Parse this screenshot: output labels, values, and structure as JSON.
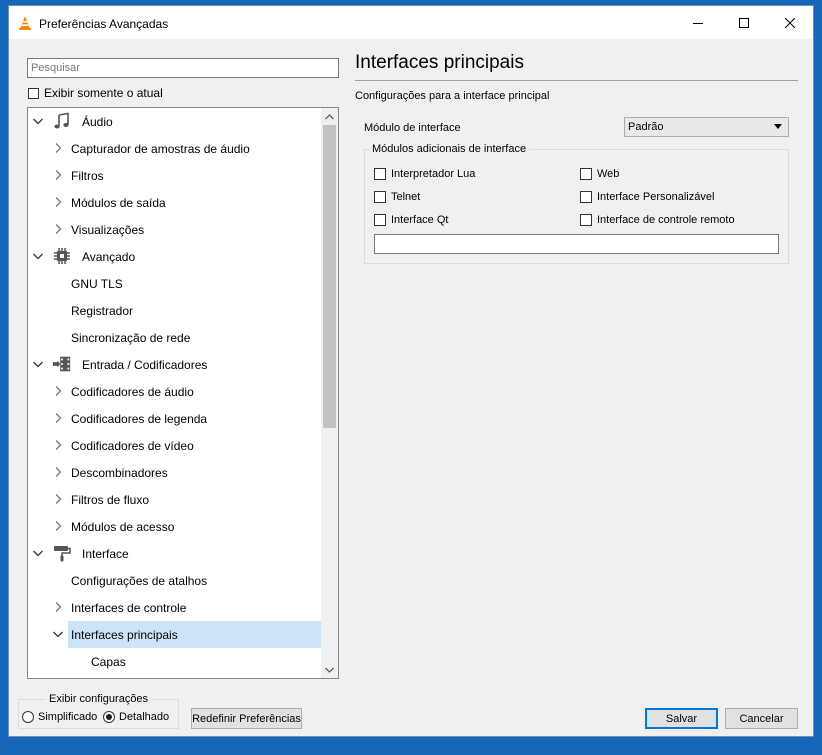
{
  "window": {
    "title": "Preferências Avançadas",
    "accent": "#1565b8"
  },
  "search": {
    "placeholder": "Pesquisar",
    "value": ""
  },
  "show_current_only": {
    "label": "Exibir somente o atual",
    "checked": false
  },
  "tree": {
    "rows": [
      {
        "label": "Áudio",
        "level": 0,
        "expander": "expanded",
        "icon": "music-note-icon"
      },
      {
        "label": "Capturador de amostras de áudio",
        "level": 1,
        "expander": "collapsed"
      },
      {
        "label": "Filtros",
        "level": 1,
        "expander": "collapsed"
      },
      {
        "label": "Módulos de saída",
        "level": 1,
        "expander": "collapsed"
      },
      {
        "label": "Visualizações",
        "level": 1,
        "expander": "collapsed"
      },
      {
        "label": "Avançado",
        "level": 0,
        "expander": "expanded",
        "icon": "chip-icon"
      },
      {
        "label": "GNU TLS",
        "level": 1,
        "expander": "none"
      },
      {
        "label": "Registrador",
        "level": 1,
        "expander": "none"
      },
      {
        "label": "Sincronização de rede",
        "level": 1,
        "expander": "none"
      },
      {
        "label": "Entrada / Codificadores",
        "level": 0,
        "expander": "expanded",
        "icon": "film-input-icon"
      },
      {
        "label": "Codificadores de áudio",
        "level": 1,
        "expander": "collapsed"
      },
      {
        "label": "Codificadores de legenda",
        "level": 1,
        "expander": "collapsed"
      },
      {
        "label": "Codificadores de vídeo",
        "level": 1,
        "expander": "collapsed"
      },
      {
        "label": "Descombinadores",
        "level": 1,
        "expander": "collapsed"
      },
      {
        "label": "Filtros de fluxo",
        "level": 1,
        "expander": "collapsed"
      },
      {
        "label": "Módulos de acesso",
        "level": 1,
        "expander": "collapsed"
      },
      {
        "label": "Interface",
        "level": 0,
        "expander": "expanded",
        "icon": "paint-roller-icon"
      },
      {
        "label": "Configurações de atalhos",
        "level": 1,
        "expander": "none"
      },
      {
        "label": "Interfaces de controle",
        "level": 1,
        "expander": "collapsed"
      },
      {
        "label": "Interfaces principais",
        "level": 1,
        "expander": "expanded",
        "selected": true
      },
      {
        "label": "Capas",
        "level": 2,
        "expander": "none"
      }
    ],
    "selected_color": "#cce4f7"
  },
  "panel": {
    "title": "Interfaces principais",
    "subtitle": "Configurações para a interface principal",
    "module_label": "Módulo de interface",
    "module_value": "Padrão",
    "extra_group_title": "Módulos adicionais de interface",
    "extra_modules": [
      {
        "label": "Interpretador Lua",
        "checked": false
      },
      {
        "label": "Web",
        "checked": false
      },
      {
        "label": "Telnet",
        "checked": false
      },
      {
        "label": "Interface Personalizável",
        "checked": false
      },
      {
        "label": "Interface Qt",
        "checked": false
      },
      {
        "label": "Interface de controle remoto",
        "checked": false
      }
    ],
    "extra_modules_value": ""
  },
  "show_settings": {
    "title": "Exibir configurações",
    "simple_label": "Simplificado",
    "detailed_label": "Detalhado",
    "selected": "detailed"
  },
  "buttons": {
    "reset": "Redefinir Preferências",
    "save": "Salvar",
    "cancel": "Cancelar"
  }
}
